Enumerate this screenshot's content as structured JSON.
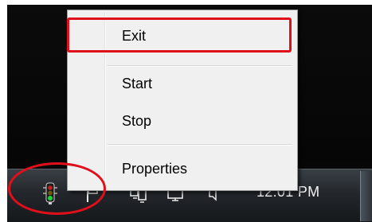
{
  "context_menu": {
    "items": [
      {
        "label": "Exit"
      },
      {
        "label": "Start"
      },
      {
        "label": "Stop"
      },
      {
        "label": "Properties"
      }
    ]
  },
  "taskbar": {
    "clock": "12:01 PM",
    "tray_icons": [
      "traffic-light-icon",
      "flag-icon",
      "network-icon",
      "display-icon",
      "volume-icon"
    ]
  },
  "colors": {
    "highlight": "#e0101a",
    "menu_background": "#f0f0f0",
    "taskbar": "#23272c"
  }
}
